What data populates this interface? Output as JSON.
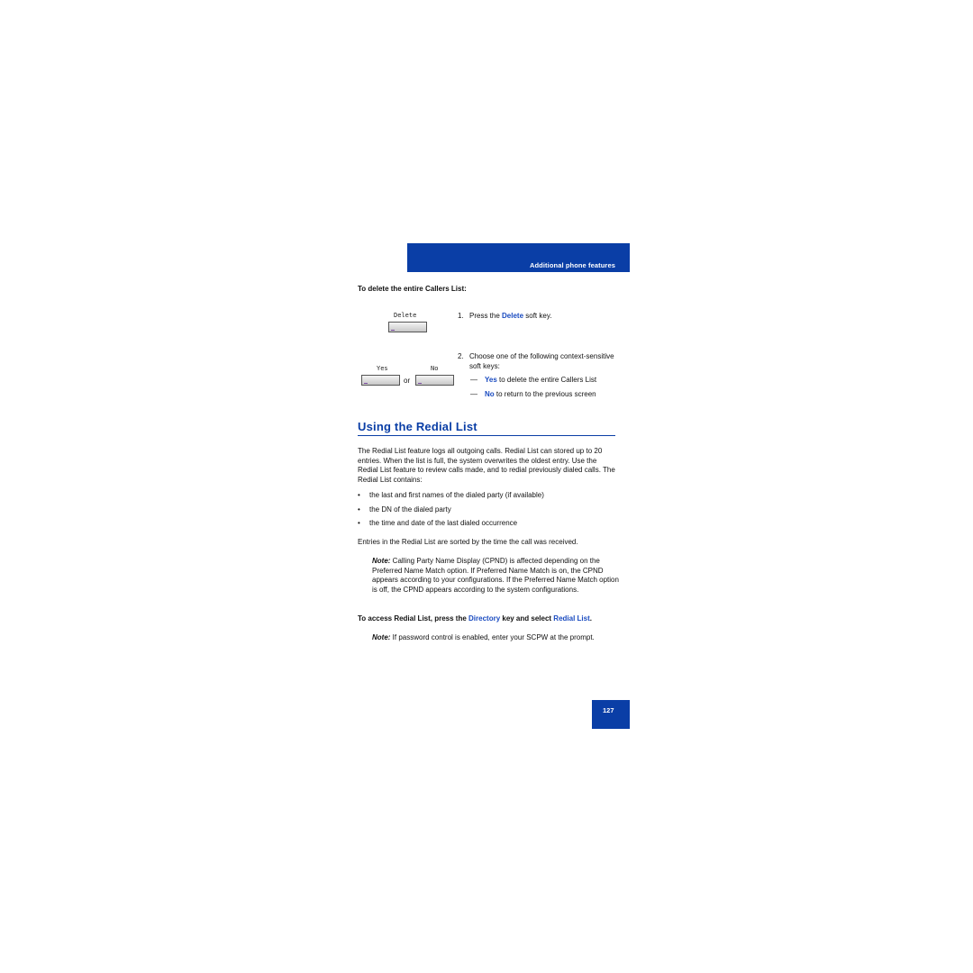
{
  "header": {
    "section_title": "Additional phone features"
  },
  "delete_callers": {
    "subheading": "To delete the entire Callers List:",
    "softkeys": {
      "delete": "Delete",
      "yes": "Yes",
      "no": "No",
      "or": "or"
    },
    "steps": [
      {
        "num": "1.",
        "pre": "Press the ",
        "key": "Delete",
        "post": " soft key."
      },
      {
        "num": "2.",
        "text": "Choose one of the following context-sensitive soft keys:"
      }
    ],
    "options": [
      {
        "dash": "—",
        "key": "Yes",
        "text": " to delete the entire Callers List"
      },
      {
        "dash": "—",
        "key": "No",
        "text": " to return to the previous screen"
      }
    ]
  },
  "redial": {
    "heading": "Using the Redial List",
    "intro": "The Redial List feature logs all outgoing calls. Redial List can stored up to 20 entries. When the list is full, the system overwrites the oldest entry. Use the Redial List feature to review calls made, and to redial previously dialed calls. The Redial List contains:",
    "bullets": [
      "the last and first names of the dialed party (if available)",
      "the DN of the dialed party",
      "the time and date of the last dialed occurrence"
    ],
    "sorted": "Entries in the Redial List are sorted by the time the call was received.",
    "note1_label": "Note:",
    "note1": " Calling Party Name Display (CPND) is affected depending on the Preferred Name Match option. If Preferred Name Match is on, the CPND appears according to your configurations. If the Preferred Name Match option is off, the CPND appears according to the system configurations.",
    "access": {
      "pre": "To access Redial List, press the ",
      "key1": "Directory",
      "mid": " key and select ",
      "key2": "Redial List",
      "post": "."
    },
    "note2_label": "Note:",
    "note2": " If password control is enabled, enter your SCPW at the prompt."
  },
  "page_number": "127",
  "colors": {
    "brand_blue": "#0a3ea6",
    "link_blue": "#1a4bc0"
  }
}
